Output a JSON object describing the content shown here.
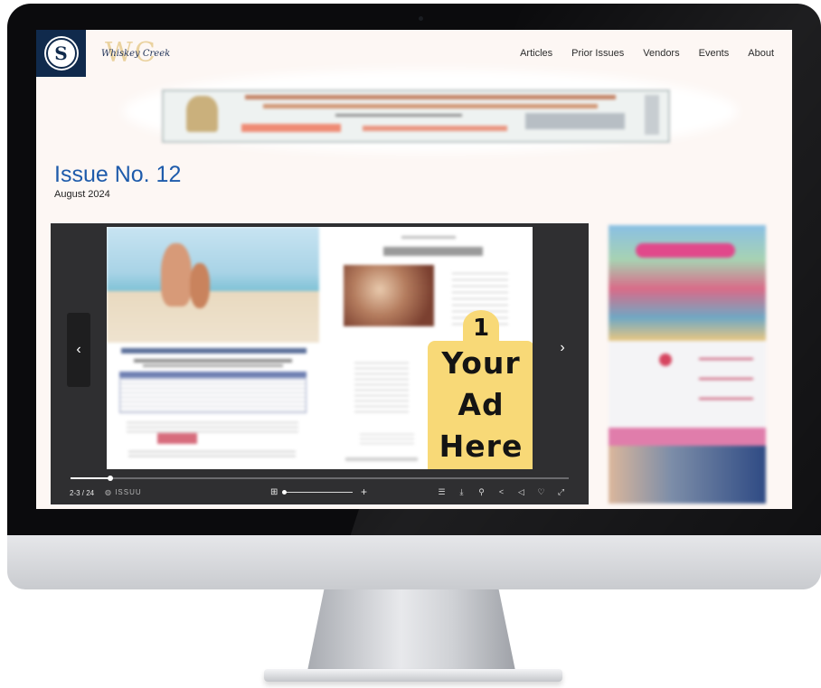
{
  "site": {
    "logo_letter": "S",
    "brand_monogram": "WC",
    "brand_name": "Whiskey Creek",
    "colors": {
      "navy": "#102a4c",
      "link_blue": "#1e5bab",
      "ad_yellow": "#f8d977"
    }
  },
  "nav": {
    "articles": "Articles",
    "prior_issues": "Prior Issues",
    "vendors": "Vendors",
    "events": "Events",
    "about": "About"
  },
  "issue": {
    "title": "Issue No. 12",
    "date": "August 2024"
  },
  "viewer": {
    "page_count": "2-3 / 24",
    "provider": "ISSUU",
    "progress_fraction": 0.08,
    "zoom_fraction": 0.0,
    "prev_icon": "chevron-left-icon",
    "next_icon": "chevron-right-icon",
    "prev_glyph": "‹",
    "next_glyph": "›",
    "grid_glyph": "⊞",
    "plus_glyph": "+",
    "tools": [
      {
        "name": "toc-icon",
        "glyph": "☰"
      },
      {
        "name": "download-icon",
        "glyph": "⤓"
      },
      {
        "name": "search-icon",
        "glyph": "⚲"
      },
      {
        "name": "share-icon",
        "glyph": "<"
      },
      {
        "name": "sound-icon",
        "glyph": "◁"
      },
      {
        "name": "like-icon",
        "glyph": "♡"
      },
      {
        "name": "fullscreen-icon",
        "glyph": "⤢"
      }
    ]
  },
  "ad_callout": {
    "number": "1",
    "line1": "Your",
    "line2": "Ad",
    "line3": "Here"
  }
}
